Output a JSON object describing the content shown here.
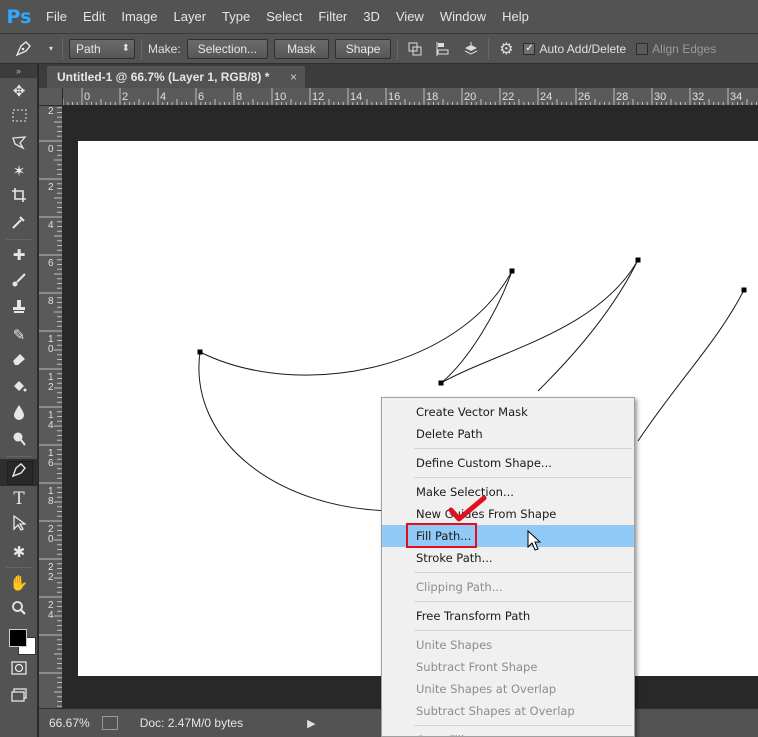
{
  "app": {
    "logo": "Ps",
    "menu": [
      "File",
      "Edit",
      "Image",
      "Layer",
      "Type",
      "Select",
      "Filter",
      "3D",
      "View",
      "Window",
      "Help"
    ]
  },
  "options_bar": {
    "tool_icon": "pen-icon",
    "mode_select": "Path",
    "make_label": "Make:",
    "selection_button": "Selection...",
    "mask_button": "Mask",
    "shape_button": "Shape",
    "auto_add_delete_label": "Auto Add/Delete",
    "auto_add_delete_checked": true,
    "align_edges_label": "Align Edges",
    "align_edges_checked": false
  },
  "document": {
    "tab_title": "Untitled-1 @ 66.7% (Layer 1, RGB/8) *",
    "close_glyph": "×"
  },
  "rulers": {
    "top_labels": [
      "0",
      "2",
      "4",
      "6",
      "8",
      "10",
      "12",
      "14",
      "16",
      "18",
      "20",
      "22",
      "24",
      "26",
      "28",
      "30",
      "32",
      "34"
    ],
    "left_labels": [
      "2",
      "0",
      "2",
      "4",
      "6",
      "8",
      "10",
      "12",
      "14",
      "16",
      "18",
      "20",
      "22",
      "24"
    ]
  },
  "status_bar": {
    "zoom": "66.67%",
    "doc_info": "Doc: 2.47M/0 bytes"
  },
  "context_menu": {
    "groups": [
      [
        {
          "label": "Create Vector Mask",
          "enabled": true
        },
        {
          "label": "Delete Path",
          "enabled": true
        }
      ],
      [
        {
          "label": "Define Custom Shape...",
          "enabled": true
        }
      ],
      [
        {
          "label": "Make Selection...",
          "enabled": true
        },
        {
          "label": "New Guides From Shape",
          "enabled": true
        },
        {
          "label": "Fill Path...",
          "enabled": true,
          "highlighted": true
        },
        {
          "label": "Stroke Path...",
          "enabled": true
        }
      ],
      [
        {
          "label": "Clipping Path...",
          "enabled": false
        }
      ],
      [
        {
          "label": "Free Transform Path",
          "enabled": true
        }
      ],
      [
        {
          "label": "Unite Shapes",
          "enabled": false
        },
        {
          "label": "Subtract Front Shape",
          "enabled": false
        },
        {
          "label": "Unite Shapes at Overlap",
          "enabled": false
        },
        {
          "label": "Subtract Shapes at Overlap",
          "enabled": false
        }
      ],
      [
        {
          "label": "Copy Fill",
          "enabled": false
        }
      ]
    ]
  },
  "colors": {
    "highlight": "#91c9f7",
    "annotation_red": "#e0101e",
    "logo_blue": "#31a8ff"
  }
}
